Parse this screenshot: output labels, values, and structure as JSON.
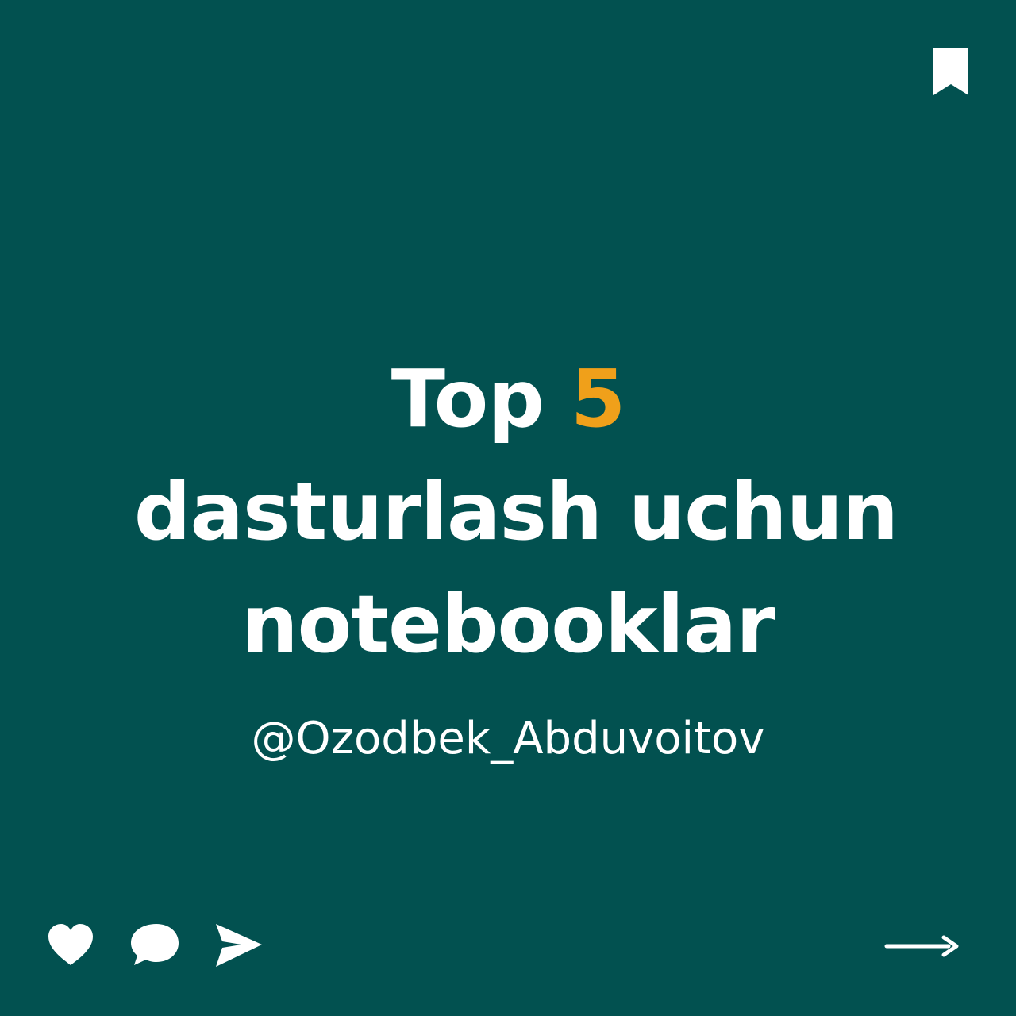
{
  "post": {
    "title": {
      "line1_prefix": "Top ",
      "line1_number": "5",
      "line2": "dasturlash uchun",
      "line3": "notebooklar"
    },
    "handle": "@Ozodbek_Abduvoitov"
  },
  "colors": {
    "background": "#025150",
    "text": "#ffffff",
    "accent": "#f0a01a"
  },
  "icons": {
    "top_right": "bookmark-icon",
    "actions": [
      "heart-icon",
      "comment-icon",
      "send-icon"
    ],
    "next": "arrow-right-icon"
  }
}
